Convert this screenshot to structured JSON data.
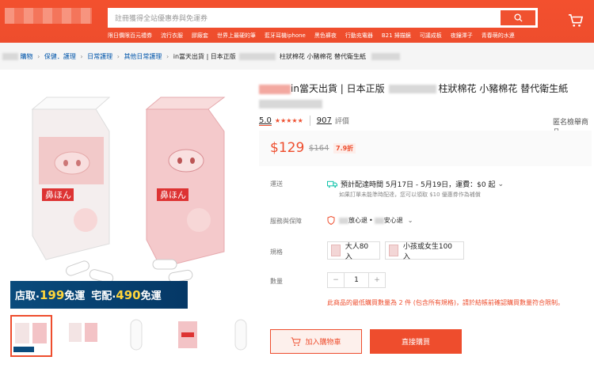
{
  "header": {
    "search_placeholder": "註冊獲得全站優惠券與免運券",
    "suggestions": [
      "限日價限百元禮券",
      "流行衣服",
      "膠廠套",
      "世界上最硬的筆",
      "藍牙耳機iphone",
      "黑色褲夜",
      "行動充電器",
      "B21 掃描鏡",
      "可議成板",
      "夜鐘澤子",
      "青春萌的水連"
    ]
  },
  "breadcrumb": {
    "items": [
      "購物",
      "保健．護理",
      "日常護理",
      "其他日常護理"
    ],
    "current": "in當天出貨 | 日本正版",
    "current_tail": "柱狀棉花 小豬棉花 替代衛生紙"
  },
  "product": {
    "title_line1_visible": "in當天出貨 | 日本正版",
    "title_line1_tail": "柱狀棉花 小豬棉花 替代衛生紙",
    "rating_score": "5.0",
    "stars": "★★★★★",
    "review_count": "907",
    "review_label": "評價",
    "report_label": "匿名檢舉商品",
    "price": "$129",
    "original_price": "$164",
    "discount": "7.9折"
  },
  "promo_banner": {
    "pickup_label": "店取",
    "pickup_amount": "199",
    "pickup_suffix": "免運",
    "home_label": "宅配",
    "home_amount": "490",
    "home_suffix": "免運"
  },
  "shipping": {
    "label": "運送",
    "line1": "預計配達時間 5月17日 - 5月19日，運費：$0 起",
    "line2": "如果訂單未能準時配達，您可以領取 $10 優惠券作為補償"
  },
  "service": {
    "label": "服務與保障",
    "text_a": "放心退",
    "text_b": "安心退"
  },
  "variations": {
    "label": "規格",
    "options": [
      "大人80入",
      "小孩或女生100入"
    ]
  },
  "quantity": {
    "label": "數量",
    "value": "1",
    "minus": "−",
    "plus": "+"
  },
  "warning": "此商品的最低購買數量為 2 件 (包含所有規格)，請於結帳前確認購買數量符合限制。",
  "buttons": {
    "add_to_cart": "加入購物車",
    "buy_now": "直接購買"
  },
  "colors": {
    "brand": "#ee4d2d",
    "promo_bg": "#0a4b7c",
    "promo_num": "#ffd53b"
  }
}
